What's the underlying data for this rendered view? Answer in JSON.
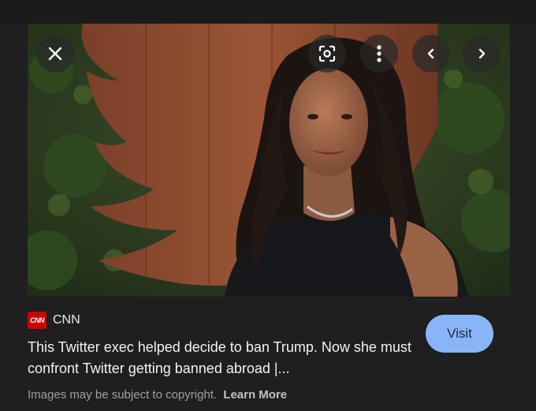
{
  "controls": {
    "close": "close-icon",
    "lens": "lens-icon",
    "more": "more-vert-icon",
    "prev": "chevron-left-icon",
    "next": "chevron-right-icon"
  },
  "result": {
    "source_logo_text": "CNN",
    "source_name": "CNN",
    "headline": "This Twitter exec helped decide to ban Trump. Now she must confront Twitter getting banned abroad |...",
    "visit_label": "Visit"
  },
  "footer": {
    "notice": "Images may be subject to copyright.",
    "learn_more": "Learn More"
  },
  "colors": {
    "background": "#1f1f1f",
    "visit_button": "#8ab4f8",
    "source_logo": "#cc0000"
  }
}
